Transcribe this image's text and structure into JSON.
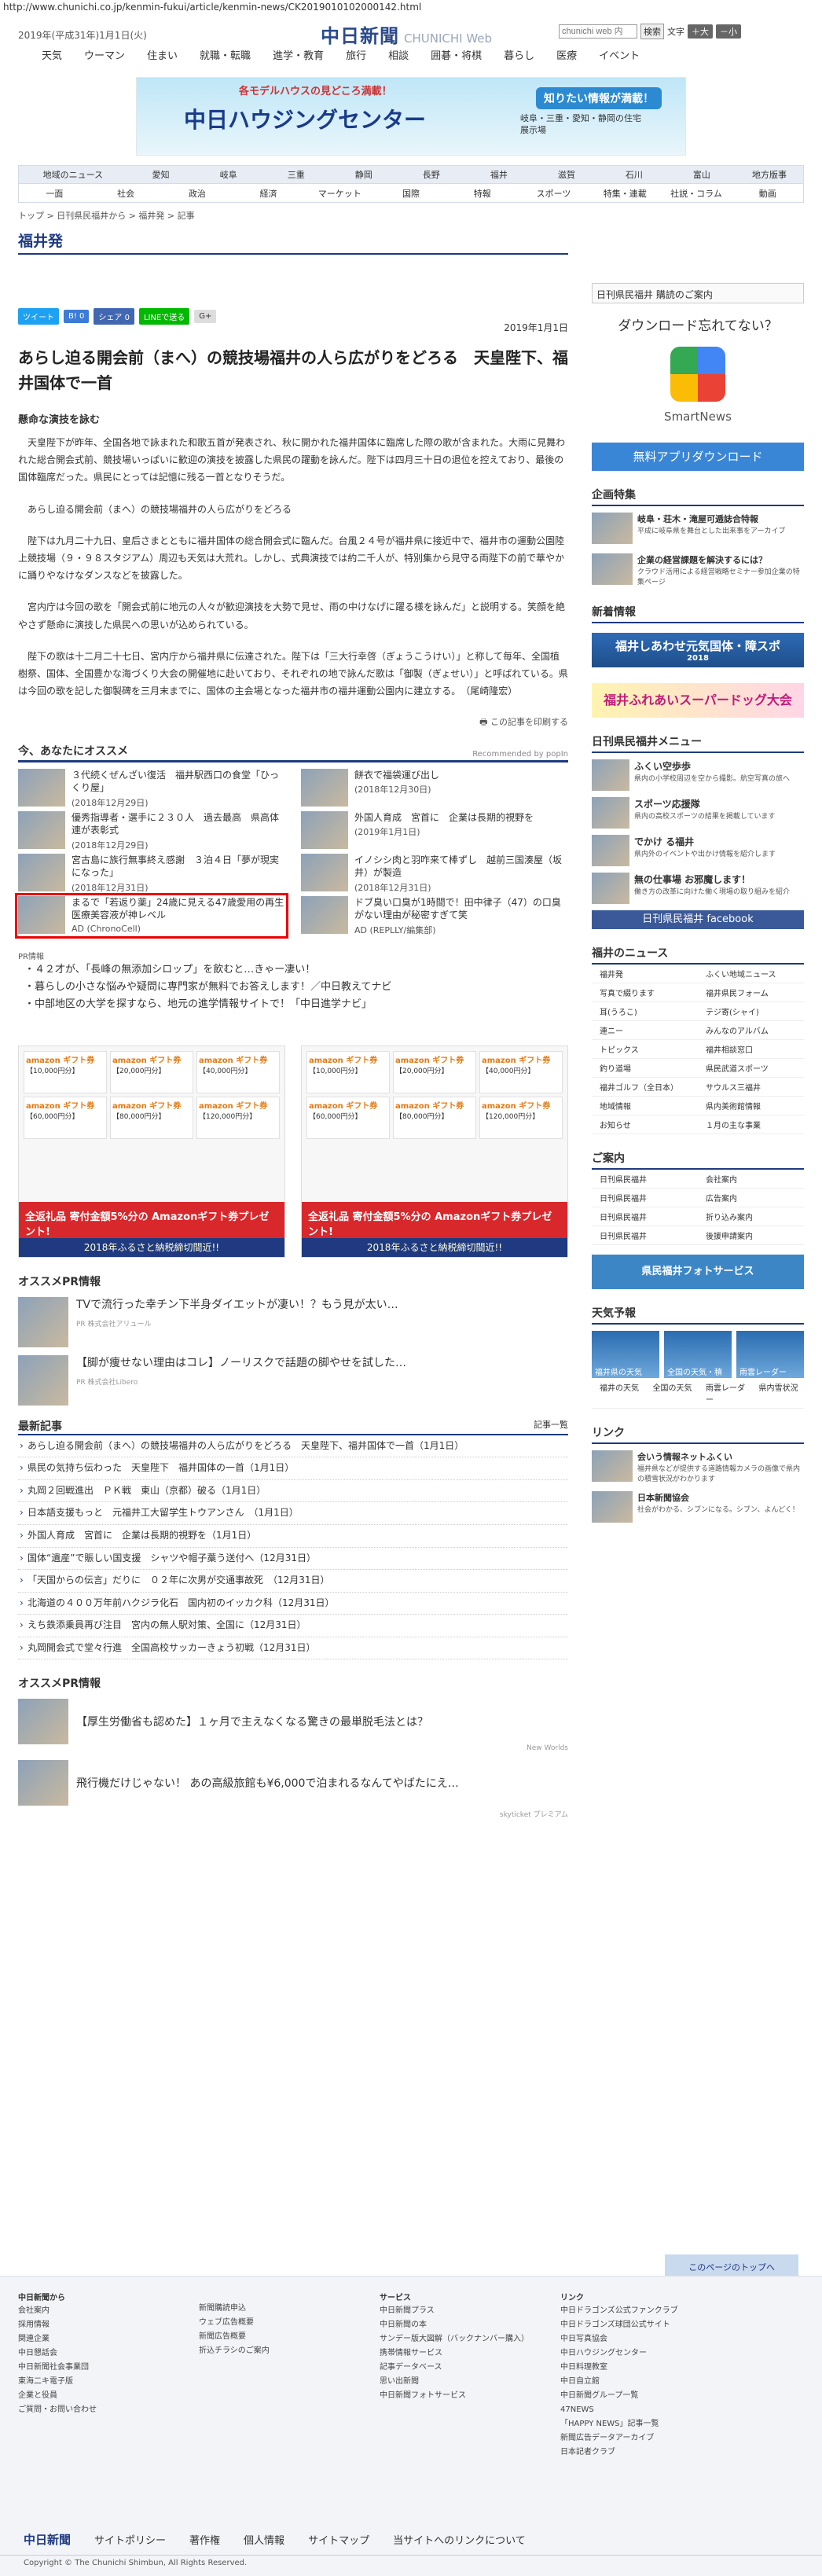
{
  "url": "http://www.chunichi.co.jp/kenmin-fukui/article/kenmin-news/CK2019010102000142.html",
  "header": {
    "date": "2019年(平成31年)1月1日(火)",
    "logo_ja": "中日新聞",
    "logo_en": "CHUNICHI Web",
    "search_placeholder": "chunichi web 内",
    "search_btn": "検索",
    "help": "文字",
    "zoom_plus": "＋大",
    "zoom_minus": "－小"
  },
  "gnav": [
    "天気",
    "ウーマン",
    "住まい",
    "就職・転職",
    "進学・教育",
    "旅行",
    "相談",
    "囲碁・将棋",
    "暮らし",
    "医療",
    "イベント"
  ],
  "banner": {
    "line1": "各モデルハウスの見どころ満載！",
    "name": "中日ハウジングセンター",
    "cta": "知りたい情報が満載！",
    "sub": "岐阜・三重・愛知・静岡の住宅展示場"
  },
  "sec_nav": {
    "r1": [
      "地域のニュース",
      "愛知",
      "岐阜",
      "三重",
      "静岡",
      "長野",
      "福井",
      "滋賀",
      "石川",
      "富山",
      "地方版事"
    ],
    "r2": [
      "一面",
      "社会",
      "政治",
      "経済",
      "マーケット",
      "国際",
      "特報",
      "スポーツ",
      "特集・連載",
      "社説・コラム",
      "動画"
    ]
  },
  "breadcrumb": "トップ > 日刊県民福井から > 福井発 > 記事",
  "section_title": "福井発",
  "social": [
    "ツイート",
    "B! 0",
    "シェア 0",
    "LINEで送る",
    "G+"
  ],
  "pubdate": "2019年1月1日",
  "headline": "あらし迫る開会前（まへ）の競技場福井の人ら広がりをどろる　天皇陛下、福井国体で一首",
  "subhead": "懸命な演技を詠む",
  "body": [
    "天皇陛下が昨年、全国各地で詠まれた和歌五首が発表され、秋に開かれた福井国体に臨席した際の歌が含まれた。大雨に見舞われた総合開会式前、競技場いっぱいに歓迎の演技を披露した県民の躍動を詠んだ。陛下は四月三十日の退位を控えており、最後の国体臨席だった。県民にとっては記憶に残る一首となりそうだ。",
    "あらし迫る開会前（まへ）の競技場福井の人ら広がりをどろる",
    "陛下は九月二十九日、皇后さまとともに福井国体の総合開会式に臨んだ。台風２４号が福井県に接近中で、福井市の運動公園陸上競技場（９・９８スタジアム）周辺も天気は大荒れ。しかし、式典演技では約二千人が、特別集から見守る両陛下の前で華やかに踊りやなけなダンスなどを披露した。",
    "宮内庁は今回の歌を「開会式前に地元の人々が歓迎演技を大勢で見せ、雨の中けなげに躍る様を詠んだ」と説明する。笑顔を絶やさず懸命に演技した県民への思いが込められている。",
    "陛下の歌は十二月二十七日、宮内庁から福井県に伝達された。陛下は「三大行幸啓（ぎょうこうけい）」と称して毎年、全国植樹祭、国体、全国豊かな海づくり大会の開催地に赴いており、それぞれの地で詠んだ歌は「御製（ぎょせい）」と呼ばれている。県は今回の歌を記した御製碑を三月末までに、国体の主会場となった福井市の福井運動公園内に建立する。　（尾崎隆宏）"
  ],
  "print": "この記事を印刷する",
  "recommend": {
    "title": "今、あなたにオススメ",
    "powered": "Recommended by popIn",
    "items": [
      {
        "t": "３代続くぜんざい復活　福井駅西口の食堂「ひっくり屋」",
        "d": "(2018年12月29日)"
      },
      {
        "t": "餅衣で福袋運び出し",
        "d": "(2018年12月30日)"
      },
      {
        "t": "優秀指導者・選手に２３０人　過去最高　県高体連が表彰式",
        "d": "(2018年12月29日)"
      },
      {
        "t": "外国人育成　宮首に　企業は長期的視野を",
        "d": "(2019年1月1日)"
      },
      {
        "t": "宮古島に族行無事終え感謝　３泊４日「夢が現実になった」",
        "d": "(2018年12月31日)"
      },
      {
        "t": "イノシシ肉と羽咋来て棒ずし　越前三国湊屋（坂井）が製造",
        "d": "(2018年12月31日)"
      },
      {
        "t": "まるで「若返り薬」24歳に見える47歳愛用の再生医療美容液が神レベル",
        "d": "AD (ChronoCell)"
      },
      {
        "t": "ドブ臭い口臭が1時間で！田中律子（47）の口臭がない理由が秘密すぎて笑",
        "d": "AD (REPLLY/編集部)"
      }
    ]
  },
  "pr": {
    "label": "PR情報",
    "items": [
      "４２才が、「長峰の無添加シロップ」を飲むと…きゃー凄い！",
      "暮らしの小さな悩みや疑問に専門家が無料でお答えします！／中日教えてナビ",
      "中部地区の大学を探すなら、地元の進学情報サイトで！「中日進学ナビ」"
    ]
  },
  "amazon": {
    "brand": "amazon ギフト券",
    "cells": [
      "【10,000円分】",
      "【20,000円分】",
      "【40,000円分】",
      "【60,000円分】",
      "【80,000円分】",
      "【120,000円分】"
    ],
    "cta": "全返礼品 寄付金額5%分の Amazonギフト券プレゼント!",
    "footer": "2018年ふるさと納税締切間近!!"
  },
  "pr_osusume": {
    "title": "オススメPR情報",
    "items": [
      {
        "t": "TVで流行った幸チン下半身ダイエットが凄い！？もう見が太い…",
        "ad": "PR 株式会社アリュール"
      },
      {
        "t": "【脚が痩せない理由はコレ】ノーリスクで話題の脚やせを試した…",
        "ad": "PR 株式会社Libero"
      }
    ]
  },
  "latest": {
    "title": "最新記事",
    "more": "記事一覧",
    "items": [
      "あらし迫る開会前（まへ）の競技場福井の人ら広がりをどろる　天皇陛下、福井国体で一首（1月1日）",
      "県民の気持ち伝わった　天皇陛下　福井国体の一首（1月1日）",
      "丸岡２回戦進出　ＰＫ戦　東山（京都）破る（1月1日）",
      "日本語支援もっと　元福井工大留学生トウアンさん　（1月1日）",
      "外国人育成　宮首に　企業は長期的視野を（1月1日）",
      "国体“遺産”で賑しい国支援　シャツや帽子藁う送付へ（12月31日）",
      "「天国からの伝言」だりに　０２年に次男が交通事故死　（12月31日）",
      "北海道の４００万年前ハクジラ化石　国内初のイッカク科（12月31日）",
      "えち鉄添乗員再び注目　宮内の無人駅対策、全国に（12月31日）",
      "丸岡開会式で堂々行進　全国高校サッカーきょう初戦（12月31日）"
    ]
  },
  "pr_osusume2": {
    "title": "オススメPR情報",
    "items": [
      "【厚生労働省も認めた】１ヶ月で主えなくなる驚きの最単脱毛法とは？",
      "飛行機だけじゃない！ あの高級旅館も¥6,000で泊まれるなんてやばたにえ…"
    ],
    "src": "New Worlds",
    "src2": "skyticket プレミアム"
  },
  "side": {
    "ad1": "日刊県民福井 購読のご案内",
    "dl_title": "ダウンロード忘れてない？",
    "dl_app": "SmartNews",
    "dl_btn": "無料アプリダウンロード",
    "kikaku_title": "企画特集",
    "kikaku": [
      {
        "t": "岐阜・荘木・滝屋可逓誌合特報",
        "d": "平成に岐阜県を舞台とした出来事をアーカイブ"
      },
      {
        "t": "企業の経営課題を解決するには？",
        "d": "クラウド活用による経営戦略セミナー参加企業の特集ページ"
      }
    ],
    "shinsai": "新着情報",
    "banner1": "福井しあわせ元気国体・障スポ",
    "banner1s": "2018",
    "banner2": "福井ふれあいスーパードッグ大会",
    "menu_title": "日刊県民福井メニュー",
    "menu": [
      {
        "t": "ふくい空歩歩",
        "d": "県内の小学校周辺を空から撮影。航空写真の旅へ"
      },
      {
        "t": "スポーツ応援隊",
        "d": "県内の高校スポーツの結果を掲載しています"
      },
      {
        "t": "でかけ る福井",
        "d": "県内外のイベントや出かけ情報を紹介します"
      },
      {
        "t": "無の仕事場 お邪魔します！",
        "d": "働き方の改革に向けた働く現場の取り組みを紹介"
      }
    ],
    "fb": "日刊県民福井 facebook",
    "news_title": "福井のニュース",
    "news": [
      "福井発",
      "ふくい地域ニュース",
      "写真で綴ります",
      "福井県民フォーム",
      "耳(うろこ)",
      "テジ寄(シャイ)",
      "連ニー",
      "みんなのアルバム",
      "トピックス",
      "福井相談窓口",
      "釣り道場",
      "県民武道スポーツ",
      "福井ゴルフ（全日本）",
      "サウルス三福井",
      "地域情報",
      "県内美術館情報",
      "お知らせ",
      "１月の主な事業"
    ],
    "annai_title": "ご案内",
    "annai": [
      "日刊県民福井",
      "会社案内",
      "日刊県民福井",
      "広告案内",
      "日刊県民福井",
      "折り込み案内",
      "日刊県民福井",
      "後援申請案内"
    ],
    "photo": "県民福井フォトサービス",
    "weather_title": "天気予報",
    "weather": [
      "福井県の天気",
      "全国の天気・積雪",
      "雨雲レーダー"
    ],
    "weather_links": [
      "福井の天気",
      "全国の天気",
      "雨雲レーダー",
      "県内雪状況"
    ],
    "link_title": "リンク",
    "links": [
      {
        "t": "会いう情報ネットふくい",
        "d": "福井県などが提供する道路情報カメラの画像で県内の積雪状況がわかります"
      },
      {
        "t": "日本新聞協会",
        "d": "社会がわかる、シブンになる。シブン、よんどく！"
      }
    ]
  },
  "totop": "このページのトップへ",
  "footer": {
    "c1": [
      "中日新聞から",
      "会社案内",
      "採用情報",
      "関連企業",
      "中日懇話会",
      "中日新聞社会事業団",
      "東海二キ電子版",
      "企業と役員",
      "ご質問・お問い合わせ"
    ],
    "c2": [
      "新聞購読申込",
      "ウェブ広告概要",
      "新聞広告概要",
      "折込チラシのご案内"
    ],
    "c3": [
      "サービス",
      "中日新聞プラス",
      "中日新聞の本",
      "サンデー版大図解（バックナンバー購入）",
      "携帯情報サービス",
      "記事データベース",
      "思い出新聞",
      "中日新聞フォトサービス"
    ],
    "c4": [
      "リンク",
      "中日ドラゴンズ公式ファンクラブ",
      "中日ドラゴンズ球団公式サイト",
      "中日写真協会",
      "中日ハウジングセンター",
      "中日料理教室",
      "中日自立館",
      "中日新聞グループ一覧",
      "47NEWS",
      "「HAPPY NEWS」記事一覧",
      "新聞広告データアーカイブ",
      "日本記者クラブ"
    ],
    "links": [
      "中日新聞",
      "サイトポリシー",
      "著作権",
      "個人情報",
      "サイトマップ",
      "当サイトへのリンクについて"
    ],
    "copyright": "Copyright © The Chunichi Shimbun, All Rights Reserved."
  }
}
